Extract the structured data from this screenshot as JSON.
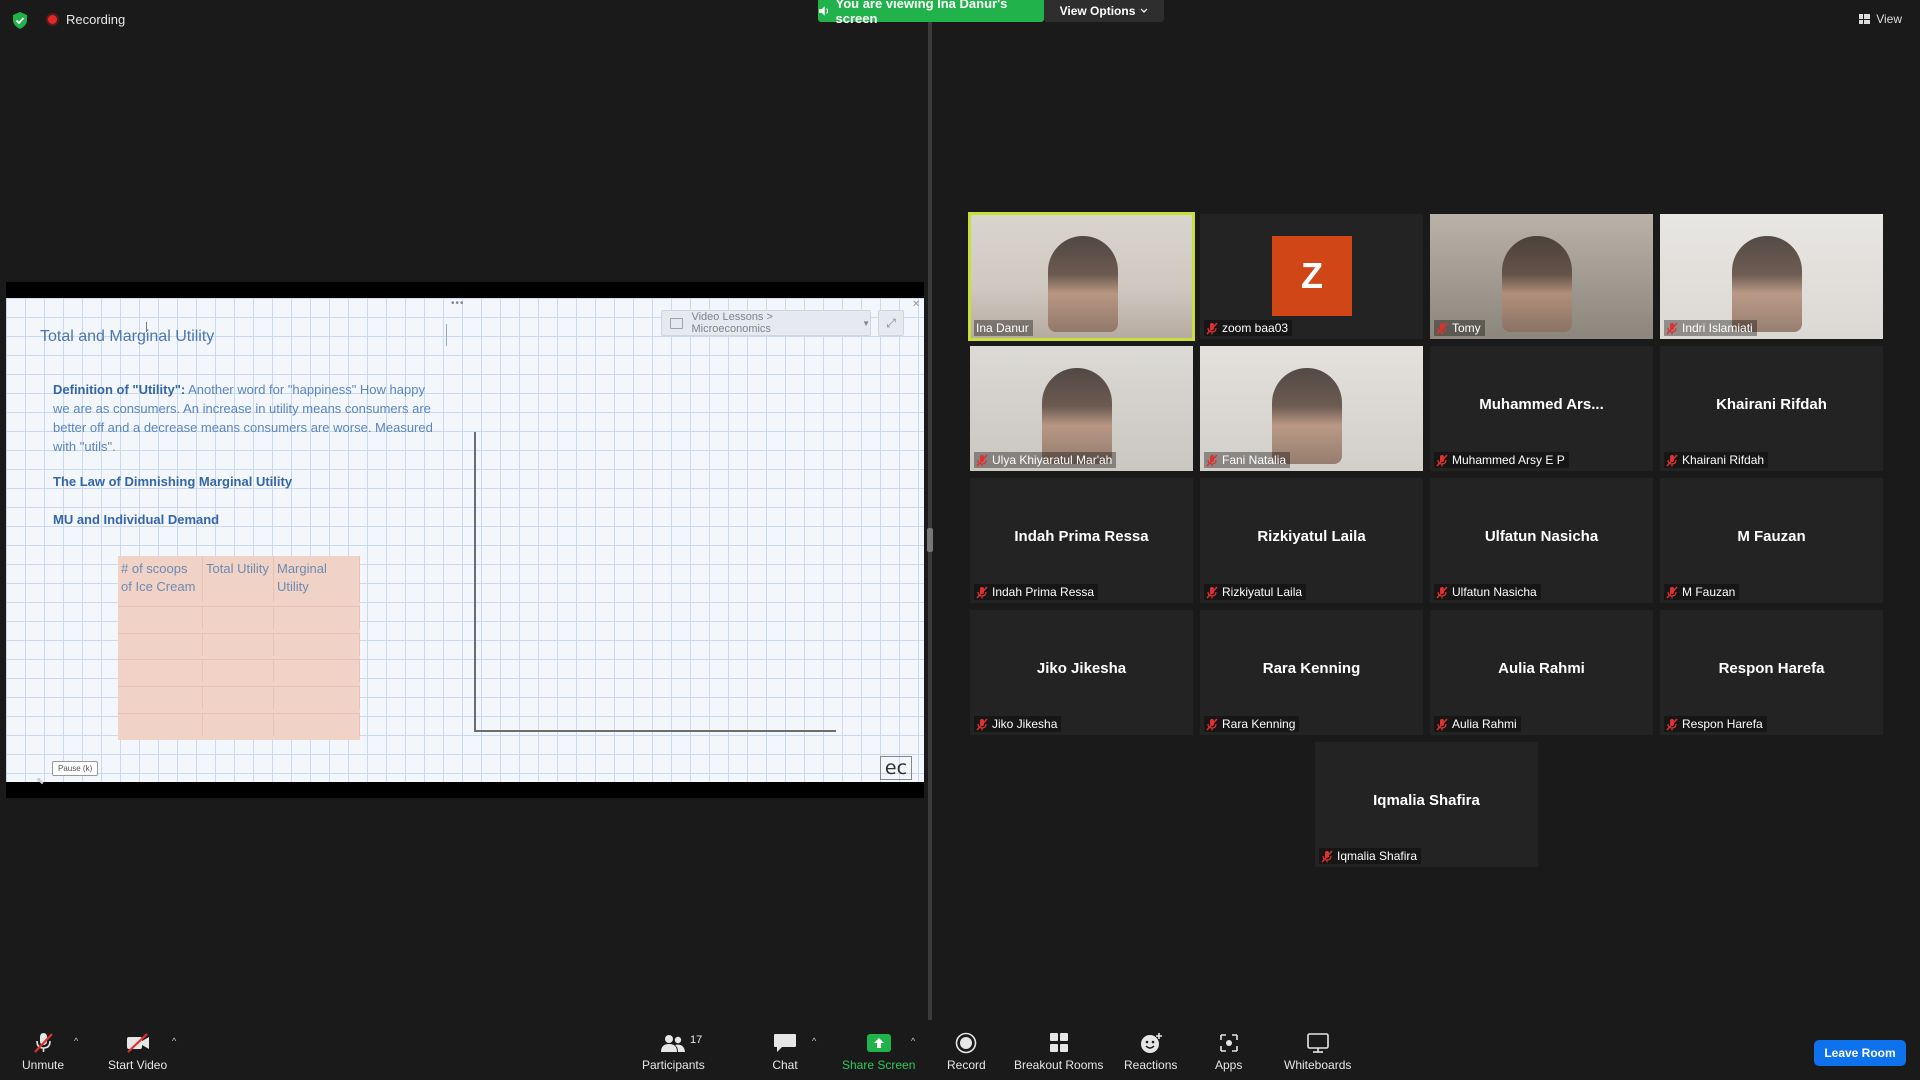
{
  "top_bar": {
    "recording_label": "Recording",
    "viewing_banner": "You are viewing Ina Danur's screen",
    "view_options_label": "View Options",
    "view_label": "View"
  },
  "shared_slide": {
    "breadcrumb": "Video Lessons > Microeconomics",
    "title": "Total and Marginal Utility",
    "definition_bold": "Definition of \"Utility\":",
    "definition_text": " Another word for \"happiness\" How happy we are as consumers. An increase in utility means consumers are better off and a decrease means consumers are worse. Measured with \"utils\".",
    "law_heading": "The Law of Dimnishing Marginal Utility",
    "mu_heading": "MU and Individual Demand",
    "table_headers": [
      "# of scoops of Ice Cream",
      "Total Utility",
      "Marginal Utility"
    ],
    "table_rows": 5,
    "pause_button": "Pause (k)",
    "logo_text": "ec"
  },
  "participants": [
    {
      "tile_name": "",
      "label": "Ina Danur",
      "video": true,
      "muted": false,
      "active": true
    },
    {
      "tile_name": "",
      "label": "zoom baa03",
      "video": false,
      "avatar_letter": "Z",
      "muted": true
    },
    {
      "tile_name": "",
      "label": "Tomy",
      "video": true,
      "muted": true
    },
    {
      "tile_name": "",
      "label": "Indri Islamiati",
      "video": true,
      "muted": true
    },
    {
      "tile_name": "",
      "label": "Ulya Khiyaratul Mar'ah",
      "video": true,
      "muted": true
    },
    {
      "tile_name": "",
      "label": "Fani Natalia",
      "video": true,
      "muted": true
    },
    {
      "tile_name": "Muhammed  Ars...",
      "label": "Muhammed Arsy E P",
      "video": false,
      "muted": true
    },
    {
      "tile_name": "Khairani Rifdah",
      "label": "Khairani Rifdah",
      "video": false,
      "muted": true
    },
    {
      "tile_name": "Indah Prima Ressa",
      "label": "Indah Prima Ressa",
      "video": false,
      "muted": true
    },
    {
      "tile_name": "Rizkiyatul Laila",
      "label": "Rizkiyatul Laila",
      "video": false,
      "muted": true
    },
    {
      "tile_name": "Ulfatun Nasicha",
      "label": "Ulfatun Nasicha",
      "video": false,
      "muted": true
    },
    {
      "tile_name": "M Fauzan",
      "label": "M Fauzan",
      "video": false,
      "muted": true
    },
    {
      "tile_name": "Jiko Jikesha",
      "label": "Jiko Jikesha",
      "video": false,
      "muted": true
    },
    {
      "tile_name": "Rara Kenning",
      "label": "Rara Kenning",
      "video": false,
      "muted": true
    },
    {
      "tile_name": "Aulia Rahmi",
      "label": "Aulia Rahmi",
      "video": false,
      "muted": true
    },
    {
      "tile_name": "Respon Harefa",
      "label": "Respon Harefa",
      "video": false,
      "muted": true
    },
    {
      "tile_name": "Iqmalia Shafira",
      "label": "Iqmalia Shafira",
      "video": false,
      "muted": true
    }
  ],
  "toolbar": {
    "unmute": "Unmute",
    "start_video": "Start Video",
    "participants": "Participants",
    "participants_count": "17",
    "chat": "Chat",
    "share_screen": "Share Screen",
    "record": "Record",
    "breakout_rooms": "Breakout Rooms",
    "reactions": "Reactions",
    "apps": "Apps",
    "whiteboards": "Whiteboards",
    "leave_room": "Leave Room"
  },
  "colors": {
    "active_speaker": "#c8e03a",
    "share_banner": "#22b24c",
    "leave_button": "#0e72ed",
    "avatar_z": "#d14616",
    "muted_icon": "#e0302f"
  }
}
